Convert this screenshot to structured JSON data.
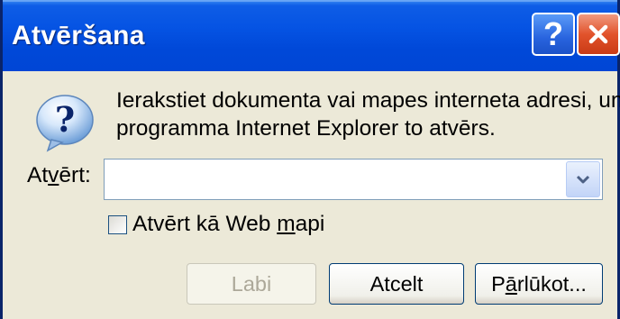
{
  "window": {
    "title": "Atvēršana"
  },
  "titlebar": {
    "help_label": "?"
  },
  "message": {
    "line1": "Ierakstiet dokumenta vai mapes interneta adresi, un",
    "line2": "programma Internet Explorer to atvērs."
  },
  "open_field": {
    "label_prefix": "At",
    "label_accel": "v",
    "label_suffix": "ērt:",
    "value": ""
  },
  "web_folder_checkbox": {
    "label_prefix": "Atvērt kā Web ",
    "label_accel": "m",
    "label_suffix": "api",
    "checked": false
  },
  "buttons": {
    "ok_label": "Labi",
    "cancel_label": "Atcelt",
    "browse_prefix": "P",
    "browse_accel": "ā",
    "browse_suffix": "rlūkot..."
  },
  "icons": {
    "message_icon": "question-icon",
    "help": "help-icon",
    "close": "close-icon",
    "dropdown": "chevron-down-icon"
  }
}
